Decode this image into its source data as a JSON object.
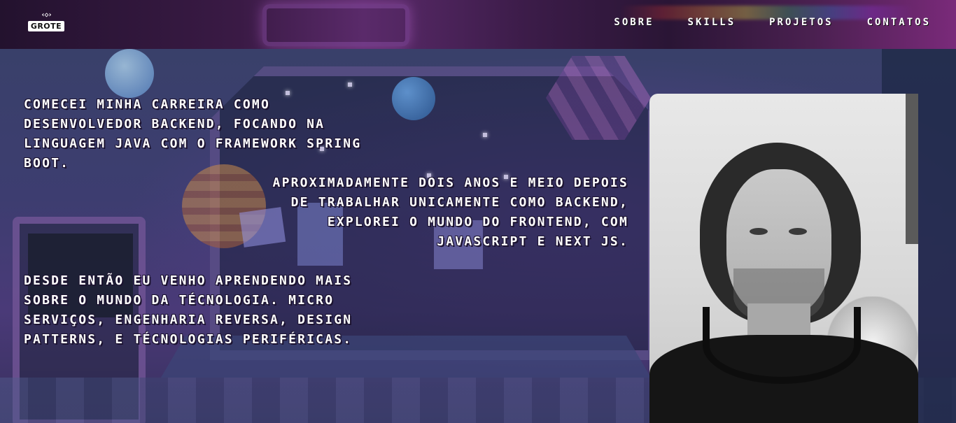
{
  "brand": {
    "logo_mark": "‹◇›",
    "logo_text": "GROTE"
  },
  "nav": {
    "items": [
      {
        "label": "SOBRE"
      },
      {
        "label": "SKILLS"
      },
      {
        "label": "PROJETOS"
      },
      {
        "label": "CONTATOS"
      }
    ]
  },
  "about": {
    "paragraph_1": "Comecei minha carreira como desenvolvedor backend, focando na linguagem Java com o framework Spring Boot.",
    "paragraph_2": "Aproximadamente dois anos e meio depois de trabalhar unicamente como backend, explorei o mundo do frontend, com Javascript e Next Js.",
    "paragraph_3": "Desde então eu venho aprendendo mais sobre o mundo da técnologia. micro serviços, engenharia reversa, design patterns, e técnologias periféricas."
  },
  "colors": {
    "header_bg": "#2a1535",
    "text": "#ffffff",
    "text_shadow": "#1c1330",
    "scene_bg": "#3d3d70"
  }
}
